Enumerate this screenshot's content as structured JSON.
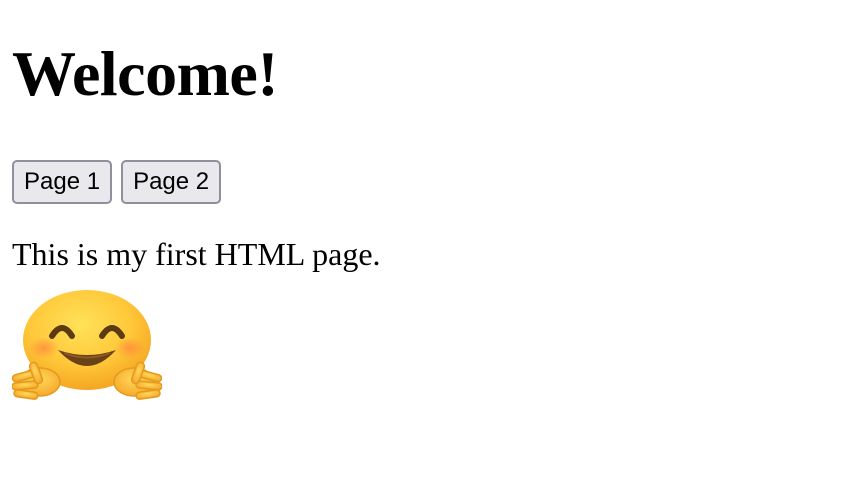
{
  "heading": "Welcome!",
  "buttons": [
    {
      "label": "Page 1"
    },
    {
      "label": "Page 2"
    }
  ],
  "paragraph": "This is my first HTML page.",
  "emoji": {
    "icon": "hugging-face-icon"
  }
}
